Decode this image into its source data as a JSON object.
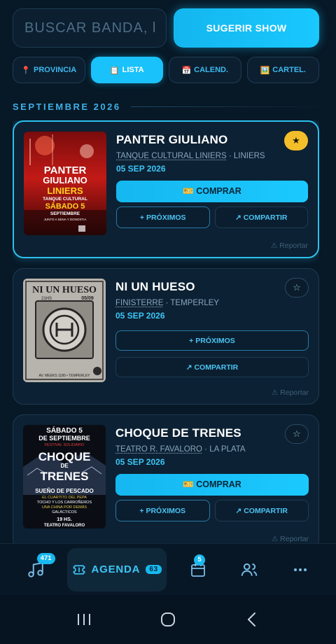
{
  "search": {
    "placeholder": "BUSCAR BANDA, l",
    "value": ""
  },
  "suggest_button": "SUGERIR SHOW",
  "views": [
    {
      "icon": "📍",
      "label": "PROVINCIA",
      "active": false
    },
    {
      "icon": "📋",
      "label": "LISTA",
      "active": true
    },
    {
      "icon": "📅",
      "label": "CALEND.",
      "active": false
    },
    {
      "icon": "🖼️",
      "label": "CARTEL.",
      "active": false
    }
  ],
  "section_title": "SEPTIEMBRE 2026",
  "events": [
    {
      "band": "PANTER GIULIANO",
      "venue": "TANQUE CULTURAL LINIERS",
      "city": "LINIERS",
      "date": "05 SEP 2026",
      "favorite": true,
      "buy_label": "🎫 COMPRAR",
      "next_label": "+ PRÓXIMOS",
      "share_label": "↗ COMPARTIR",
      "report_label": "⚠ Reportar",
      "poster": {
        "line1": "PANTER",
        "line2": "GIULIANO",
        "line3": "LINIERS",
        "line4": "TANQUE CULTURAL",
        "line5": "SÁBADO 5",
        "line6": "SEPTIEMBRE",
        "line7": "JUNTO A SENA Y DONOSTIA"
      }
    },
    {
      "band": "NI UN HUESO",
      "venue": "FINISTERRE",
      "city": "TEMPERLEY",
      "date": "05 SEP 2026",
      "favorite": false,
      "next_label": "+ PRÓXIMOS",
      "share_label": "↗ COMPARTIR",
      "report_label": "⚠ Reportar",
      "poster": {
        "title": "NI UN HUESO",
        "footer": "AV. MEEKS 1180 • TEMPERLEY",
        "date": "05/09",
        "time": "21HS"
      }
    },
    {
      "band": "CHOQUE DE TRENES",
      "venue": "TEATRO R. FAVALORO",
      "city": "LA PLATA",
      "date": "05 SEP 2026",
      "favorite": false,
      "buy_label": "🎫 COMPRAR",
      "next_label": "+ PRÓXIMOS",
      "share_label": "↗ COMPARTIR",
      "report_label": "⚠ Reportar",
      "poster": {
        "top": "SÁBADO 5",
        "top2": "DE SEPTIEMBRE",
        "tag": "FESTIVAL SOLIDARIO",
        "name1": "CHOQUE",
        "name2": "DE",
        "name3": "TRENES",
        "guest1": "SUEÑO DE PESCADO",
        "guest2": "EL CUARTITO DEL PEPA",
        "guest3": "TOCHO Y LOS CARROÑEROS",
        "guest4": "UNA CHINA POR DEMÁS",
        "guest5": "GALÁCTICOS",
        "time": "19 HS.",
        "place": "TEATRO FAVALORO"
      }
    }
  ],
  "bottom_nav": {
    "music_badge": "471",
    "agenda_label": "AGENDA",
    "agenda_count": "63",
    "calendar_badge": "5"
  },
  "colors": {
    "accent": "#19c2fb",
    "background": "#071826",
    "star": "#f3be2a"
  }
}
